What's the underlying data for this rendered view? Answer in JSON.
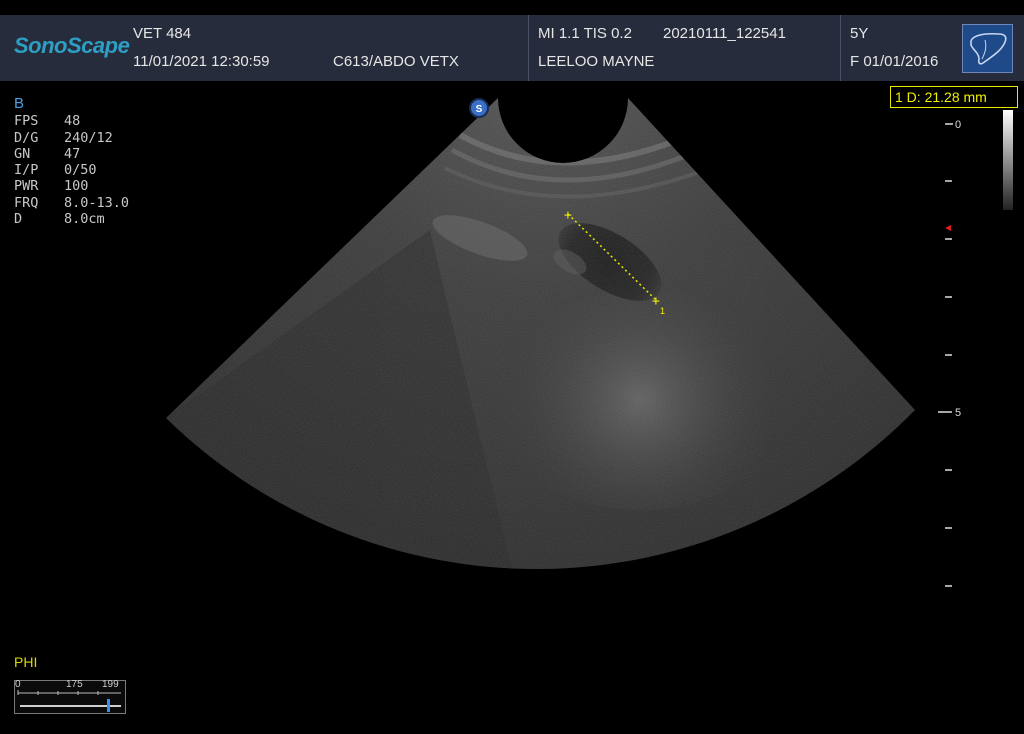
{
  "header": {
    "logo": "SonoScape",
    "institution": "VET 484",
    "datetime": "11/01/2021 12:30:59",
    "probe_preset": "C613/ABDO VETX",
    "mi_tis": "MI  1.1   TIS 0.2",
    "exam_id": "20210111_122541",
    "patient_name": "LEELOO MAYNE",
    "age": "5Y",
    "sex_dob": "F   01/01/2016",
    "preset_icon": "liver-icon"
  },
  "params": {
    "mode": "B",
    "rows": [
      {
        "label": "FPS",
        "value": "48"
      },
      {
        "label": "D/G",
        "value": "240/12"
      },
      {
        "label": "GN",
        "value": "47"
      },
      {
        "label": "I/P",
        "value": "0/50"
      },
      {
        "label": "PWR",
        "value": "100"
      },
      {
        "label": "FRQ",
        "value": "8.0-13.0"
      },
      {
        "label": "D",
        "value": "8.0cm"
      }
    ]
  },
  "measurement": {
    "text": "1  D: 21.28  mm",
    "marker_label": "1"
  },
  "depth_scale": {
    "labels": [
      "0",
      "5"
    ],
    "focus_marker_color": "#e02020"
  },
  "phi": {
    "label": "PHI",
    "scale_labels": [
      "0",
      "175",
      "199"
    ]
  },
  "colors": {
    "header_bg": "#262c3b",
    "logo": "#2e9fc4",
    "measurement": "#f0f000",
    "mode_label": "#4aa0e0"
  }
}
